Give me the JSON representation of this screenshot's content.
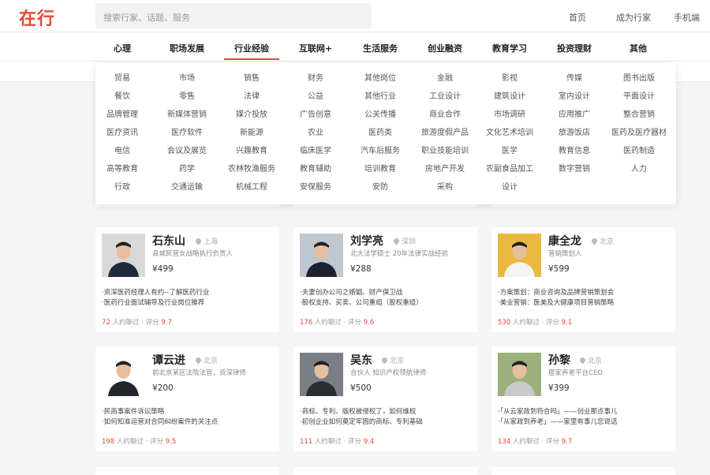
{
  "header": {
    "logo": "在行",
    "search_placeholder": "搜索行家、话题、服务",
    "links": [
      "首页",
      "成为行家",
      "手机端"
    ]
  },
  "categories": [
    "心理",
    "职场发展",
    "行业经验",
    "互联网+",
    "生活服务",
    "创业融资",
    "教育学习",
    "投资理财",
    "其他"
  ],
  "active_category": "行业经验",
  "dropdown": [
    [
      "贸易",
      "市场",
      "销售",
      "财务",
      "其他岗位",
      "金融",
      "影视",
      "传媒",
      "图书出版"
    ],
    [
      "餐饮",
      "零售",
      "法律",
      "公益",
      "其他行业",
      "工业设计",
      "建筑设计",
      "室内设计",
      "平面设计"
    ],
    [
      "品牌管理",
      "新媒体营销",
      "媒介投放",
      "广告创意",
      "公关传播",
      "商业合作",
      "市场调研",
      "应用推广",
      "整合营销"
    ],
    [
      "医疗资讯",
      "医疗软件",
      "新能源",
      "农业",
      "医药类",
      "旅游度假产品",
      "文化艺术培训",
      "旅游饭店",
      "医药及医疗器材"
    ],
    [
      "电信",
      "会议及展览",
      "兴趣教育",
      "临床医学",
      "汽车后服务",
      "职业技能培训",
      "医学",
      "教育信息",
      "医药制造"
    ],
    [
      "高等教育",
      "药学",
      "农林牧渔服务",
      "教育辅助",
      "培训教育",
      "房地产开发",
      "农副食品加工",
      "数字营销",
      "人力"
    ],
    [
      "行政",
      "交通运输",
      "机械工程",
      "安保服务",
      "安防",
      "采购",
      "设计"
    ]
  ],
  "cards": [
    {
      "name": "石东山",
      "location": "上海",
      "title": "县城民营女战略执行负责人",
      "price": "¥499",
      "topics": [
        "·资深医药经理人有约--了解医药行业",
        "·医药行业面试辅导及行业岗位推荐"
      ],
      "count": "72",
      "count_suffix": " 人约聊过",
      "rating_label": "评分",
      "rating": "9.7",
      "avatar_color": "#d9d9d9",
      "shirt": "#1f2a3c"
    },
    {
      "name": "刘学亮",
      "location": "深圳",
      "title": "北大法学硕士 20年法律实战经验",
      "price": "¥288",
      "topics": [
        "·夫妻创办公司之婚姻、财产保卫战",
        "·股权支持、买卖、公司重组（股权重组）"
      ],
      "count": "176",
      "count_suffix": " 人约聊过",
      "rating_label": "评分",
      "rating": "9.6",
      "avatar_color": "#bfc7d1",
      "shirt": "#1c2230"
    },
    {
      "name": "康全龙",
      "location": "北京",
      "title": "营销策划人",
      "price": "¥599",
      "topics": [
        "·方案策划：商业咨询及品牌营销策划会",
        "·美业营销：医美及大健康项目营销策略"
      ],
      "count": "530",
      "count_suffix": " 人约聊过",
      "rating_label": "评分",
      "rating": "9.1",
      "avatar_color": "#e8b93c",
      "shirt": "#f4f4f4"
    },
    {
      "name": "谭云进",
      "location": "北京",
      "title": "前北京某区法院法官，资深律师",
      "price": "¥200",
      "topics": [
        "·民商事案件诉讼策略",
        "·如何知准运营对合同纠纷案件的关注点"
      ],
      "count": "198",
      "count_suffix": " 人约聊过",
      "rating_label": "评分",
      "rating": "9.5",
      "avatar_color": "#ffffff",
      "shirt": "#22252b"
    },
    {
      "name": "吴东",
      "location": "北京",
      "title": "合伙人 知识产权领航律师",
      "price": "¥500",
      "topics": [
        "·商标、专利、版权被侵权了，如何维权",
        "·初创企业如何奠定牢固的商标、专利基础"
      ],
      "count": "111",
      "count_suffix": " 人约聊过",
      "rating_label": "评分",
      "rating": "9.4",
      "avatar_color": "#7a7f86",
      "shirt": "#2a2d33"
    },
    {
      "name": "孙黎",
      "location": "北京",
      "title": "居家养老平台CEO",
      "price": "¥399",
      "topics": [
        "·「从云家政到符合吗」——创业那点事儿",
        "·「从家政到养老」——家里有事儿您说话"
      ],
      "count": "134",
      "count_suffix": " 人约聊过",
      "rating_label": "评分",
      "rating": "9.7",
      "avatar_color": "#9bb07a",
      "shirt": "#c9c9c9"
    }
  ]
}
